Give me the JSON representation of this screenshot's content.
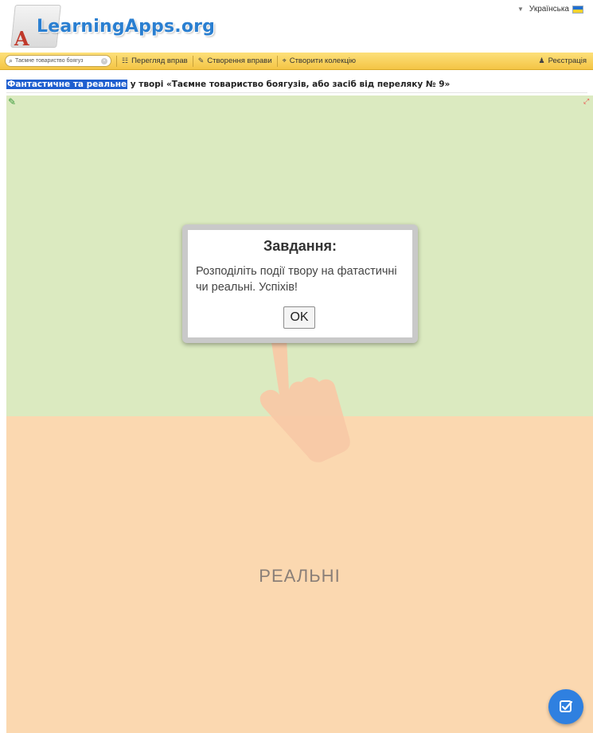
{
  "header": {
    "logo_text": "LearningApps.org",
    "language": "Українська"
  },
  "navbar": {
    "search_value": "Таємне товариство боягуз",
    "items": [
      {
        "label": "Перегляд вправ",
        "icon": "grid-icon"
      },
      {
        "label": "Створення вправи",
        "icon": "pencil-icon"
      },
      {
        "label": "Створити колекцію",
        "icon": "collection-icon"
      }
    ],
    "register_label": "Реєстрація"
  },
  "title": {
    "highlight": "Фантастичне та реальне",
    "rest": " у творі «Таємне товариство боягузів, або засіб від переляку № 9»"
  },
  "app": {
    "zone_bottom_label": "РЕАЛЬНІ"
  },
  "modal": {
    "title": "Завдання:",
    "text": "Розподіліть події твору на фатастичні чи реальні. Успіхів!",
    "ok_label": "OK"
  },
  "colors": {
    "accent": "#2a7fd1",
    "navbar": "#f4c545",
    "zone_green": "#dbeac0",
    "zone_orange": "#fbd8b0",
    "fab": "#2f80e0"
  }
}
